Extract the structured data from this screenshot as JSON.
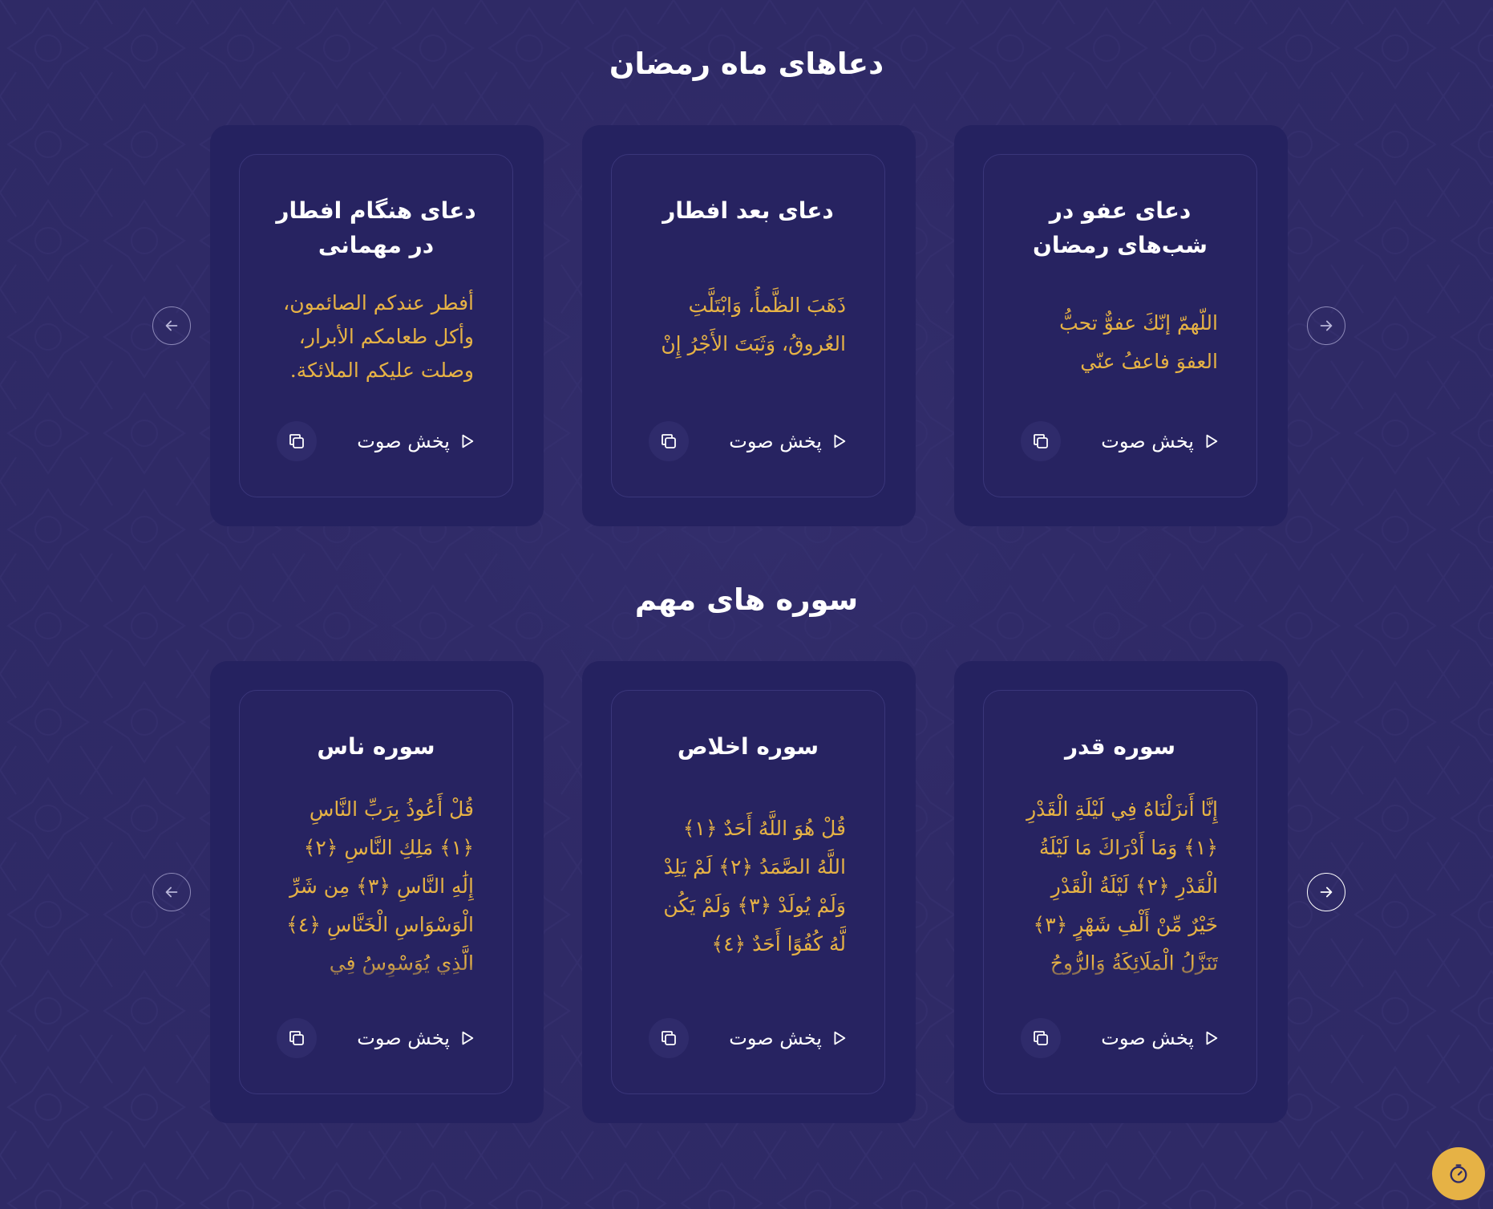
{
  "colors": {
    "background": "#2f2a66",
    "card": "#252260",
    "accent_gold": "#e6b245",
    "text": "#ffffff"
  },
  "sections": [
    {
      "title": "دعاهای ماه رمضان",
      "cards": [
        {
          "title": "دعای عفو در شب‌های رمضان",
          "text": "اللّهمّ إنّكَ عفوٌّ تحبُّ العفوَ فاعفُ عنّي",
          "play_label": "پخش صوت"
        },
        {
          "title": "دعای بعد افطار",
          "text": "ذَهَبَ الظَّمأُ، وَابْتَلَّتِ العُروقُ، وَثَبَتَ الأَجْرُ إِنْ شَاءَ اللَّهُ",
          "play_label": "پخش صوت"
        },
        {
          "title": "دعای هنگام افطار در مهمانی",
          "text": "أفطر عندكم الصائمون، وأكل طعامكم الأبرار، وصلت عليكم الملائكة.",
          "play_label": "پخش صوت"
        }
      ],
      "arrows": {
        "prev": "arrow-left-icon",
        "next": "arrow-right-icon"
      }
    },
    {
      "title": "سوره های مهم",
      "cards": [
        {
          "title": "سوره قدر",
          "text": "إِنَّا أَنزَلْنَاهُ فِي لَيْلَةِ الْقَدْرِ ﴿١﴾ وَمَا أَدْرَاكَ مَا لَيْلَةُ الْقَدْرِ ﴿٢﴾ لَيْلَةُ الْقَدْرِ خَيْرٌ مِّنْ أَلْفِ شَهْرٍ ﴿٣﴾ تَنَزَّلُ الْمَلَائِكَةُ وَالرُّوحُ فِيهَا بِإِ...",
          "play_label": "پخش صوت"
        },
        {
          "title": "سوره اخلاص",
          "text": "قُلْ هُوَ اللَّهُ أَحَدٌ ﴿١﴾ اللَّهُ الصَّمَدُ ﴿٢﴾ لَمْ يَلِدْ وَلَمْ يُولَدْ ﴿٣﴾ وَلَمْ يَكُن لَّهُ كُفُوًا أَحَدٌ ﴿٤﴾",
          "play_label": "پخش صوت"
        },
        {
          "title": "سوره ناس",
          "text": "قُلْ أَعُوذُ بِرَبِّ النَّاسِ ﴿١﴾ مَلِكِ النَّاسِ ﴿٢﴾ إِلَٰهِ النَّاسِ ﴿٣﴾ مِن شَرِّ الْوَسْوَاسِ الْخَنَّاسِ ﴿٤﴾ الَّذِي يُوَسْوِسُ فِي صُدُورِ النَّا...",
          "play_label": "پخش صوت"
        }
      ],
      "arrows": {
        "prev": "arrow-left-icon",
        "next": "arrow-right-icon"
      }
    }
  ],
  "icons": {
    "play": "play-icon",
    "copy": "copy-icon",
    "timer": "timer-icon"
  }
}
